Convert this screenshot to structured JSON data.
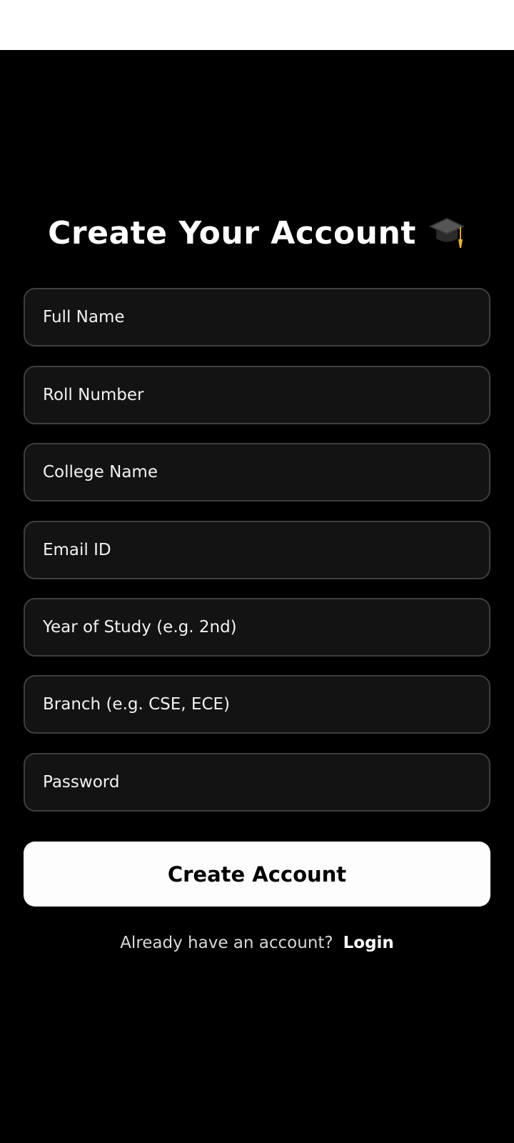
{
  "page": {
    "title": "Create Your Account",
    "title_icon": "graduation-cap-icon"
  },
  "form": {
    "fields": [
      {
        "placeholder": "Full Name"
      },
      {
        "placeholder": "Roll Number"
      },
      {
        "placeholder": "College Name"
      },
      {
        "placeholder": "Email ID"
      },
      {
        "placeholder": "Year of Study (e.g. 2nd)"
      },
      {
        "placeholder": "Branch (e.g. CSE, ECE)"
      },
      {
        "placeholder": "Password"
      }
    ],
    "submit_label": "Create Account"
  },
  "footer": {
    "prompt": "Already have an account?",
    "login_label": "Login"
  },
  "colors": {
    "background": "#000000",
    "field_background": "#131313",
    "field_border": "#3e3e3e",
    "button_background": "#fdfdfd",
    "text": "#ffffff"
  }
}
